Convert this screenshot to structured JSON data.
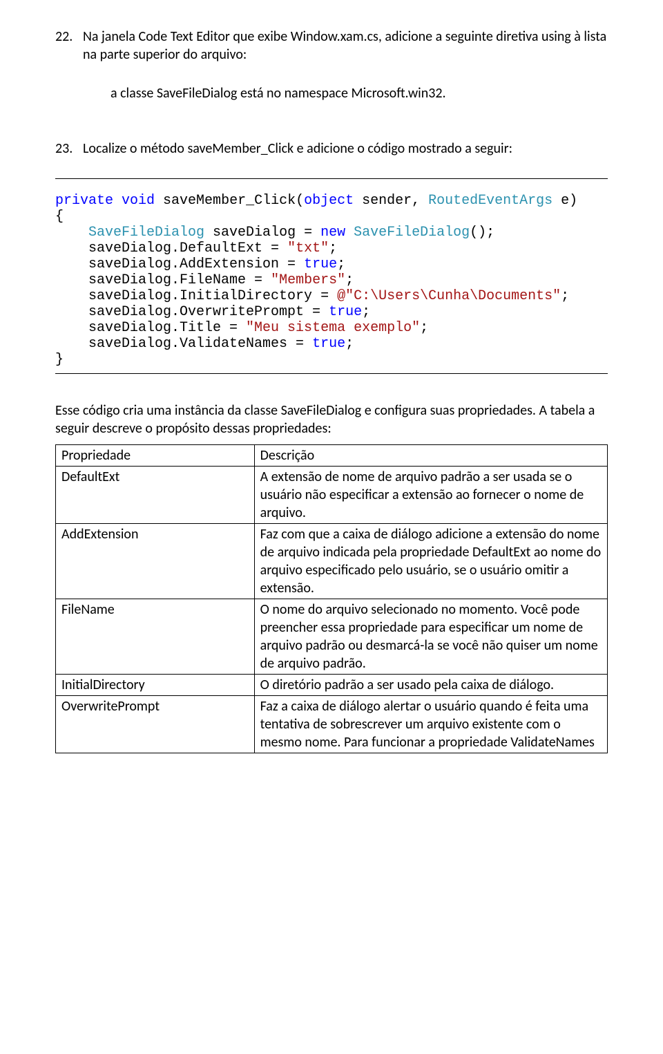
{
  "item22": {
    "num": "22.",
    "text": "Na janela Code Text Editor que exibe Window.xam.cs, adicione a seguinte diretiva using à lista na parte superior do arquivo:",
    "sub": "a classe SaveFileDialog está no namespace Microsoft.win32."
  },
  "item23": {
    "num": "23.",
    "text": "Localize o método saveMember_Click e adicione o código mostrado a seguir:"
  },
  "code": {
    "l1a": "private",
    "l1b": " ",
    "l1c": "void",
    "l1d": " saveMember_Click(",
    "l1e": "object",
    "l1f": " sender, ",
    "l1g": "RoutedEventArgs",
    "l1h": " e)",
    "l2": "{",
    "l3a": "    ",
    "l3b": "SaveFileDialog",
    "l3c": " saveDialog = ",
    "l3d": "new",
    "l3e": " ",
    "l3f": "SaveFileDialog",
    "l3g": "();",
    "l4a": "    saveDialog.DefaultExt = ",
    "l4b": "\"txt\"",
    "l4c": ";",
    "l5a": "    saveDialog.AddExtension = ",
    "l5b": "true",
    "l5c": ";",
    "l6a": "    saveDialog.FileName = ",
    "l6b": "\"Members\"",
    "l6c": ";",
    "l7a": "    saveDialog.InitialDirectory = ",
    "l7b": "@\"C:\\Users\\Cunha\\Documents\"",
    "l7c": ";",
    "l8a": "    saveDialog.OverwritePrompt = ",
    "l8b": "true",
    "l8c": ";",
    "l9a": "    saveDialog.Title = ",
    "l9b": "\"Meu sistema exemplo\"",
    "l9c": ";",
    "l10a": "    saveDialog.ValidateNames = ",
    "l10b": "true",
    "l10c": ";",
    "l11": "}"
  },
  "after_para": "Esse código cria uma instância da classe SaveFileDialog e configura suas propriedades. A tabela a seguir descreve o propósito dessas propriedades:",
  "table": {
    "h1": "Propriedade",
    "h2": "Descrição",
    "rows": [
      {
        "k": "DefaultExt",
        "v": "A extensão de nome de arquivo padrão a ser usada se o usuário não especificar a extensão ao fornecer o nome de arquivo."
      },
      {
        "k": "AddExtension",
        "v": "Faz com que a caixa de diálogo adicione a extensão do nome de arquivo indicada pela propriedade DefaultExt ao nome do arquivo especificado pelo usuário, se o usuário omitir a extensão."
      },
      {
        "k": "FileName",
        "v": "O nome do arquivo selecionado no momento. Você pode preencher essa propriedade para especificar um nome de arquivo padrão ou desmarcá-la se você não quiser um nome de arquivo padrão."
      },
      {
        "k": "InitialDirectory",
        "v": "O diretório padrão a ser usado pela caixa de diálogo."
      },
      {
        "k": "OverwritePrompt",
        "v": "Faz a caixa de diálogo alertar o usuário quando é feita uma tentativa de sobrescrever um arquivo existente com o mesmo nome. Para funcionar a propriedade ValidateNames"
      }
    ]
  }
}
